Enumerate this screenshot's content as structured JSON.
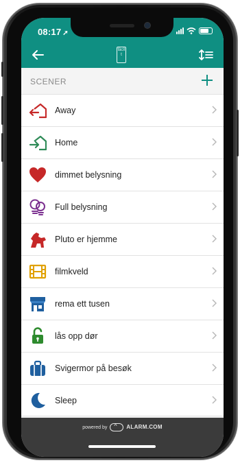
{
  "status_bar": {
    "time": "08:17",
    "location_arrow": "➚"
  },
  "nav": {
    "back_icon": "arrow-left-icon",
    "logo_text": "fâcîlt",
    "sort_icon": "sort-icon"
  },
  "section": {
    "title": "SCENER",
    "add_icon": "plus-icon"
  },
  "scenes": [
    {
      "label": "Away",
      "icon": "leave-home-icon",
      "color": "#c62828"
    },
    {
      "label": "Home",
      "icon": "enter-home-icon",
      "color": "#2e8b57"
    },
    {
      "label": "dimmet belysning",
      "icon": "heart-icon",
      "color": "#c62828"
    },
    {
      "label": "Full belysning",
      "icon": "light-bulbs-icon",
      "color": "#7b2f8f"
    },
    {
      "label": "Pluto er hjemme",
      "icon": "dog-icon",
      "color": "#c62828"
    },
    {
      "label": "filmkveld",
      "icon": "film-icon",
      "color": "#e0a000"
    },
    {
      "label": "rema ett tusen",
      "icon": "store-icon",
      "color": "#1f5f9f"
    },
    {
      "label": "lås opp dør",
      "icon": "unlock-icon",
      "color": "#2e8b2e"
    },
    {
      "label": "Svigermor på besøk",
      "icon": "suitcase-icon",
      "color": "#1f5f9f"
    },
    {
      "label": "Sleep",
      "icon": "moon-icon",
      "color": "#1f5f9f"
    }
  ],
  "footer": {
    "powered_by": "powered by",
    "brand": "ALARM.COM"
  },
  "colors": {
    "header": "#0f8f82",
    "footer": "#3b3b3b"
  }
}
